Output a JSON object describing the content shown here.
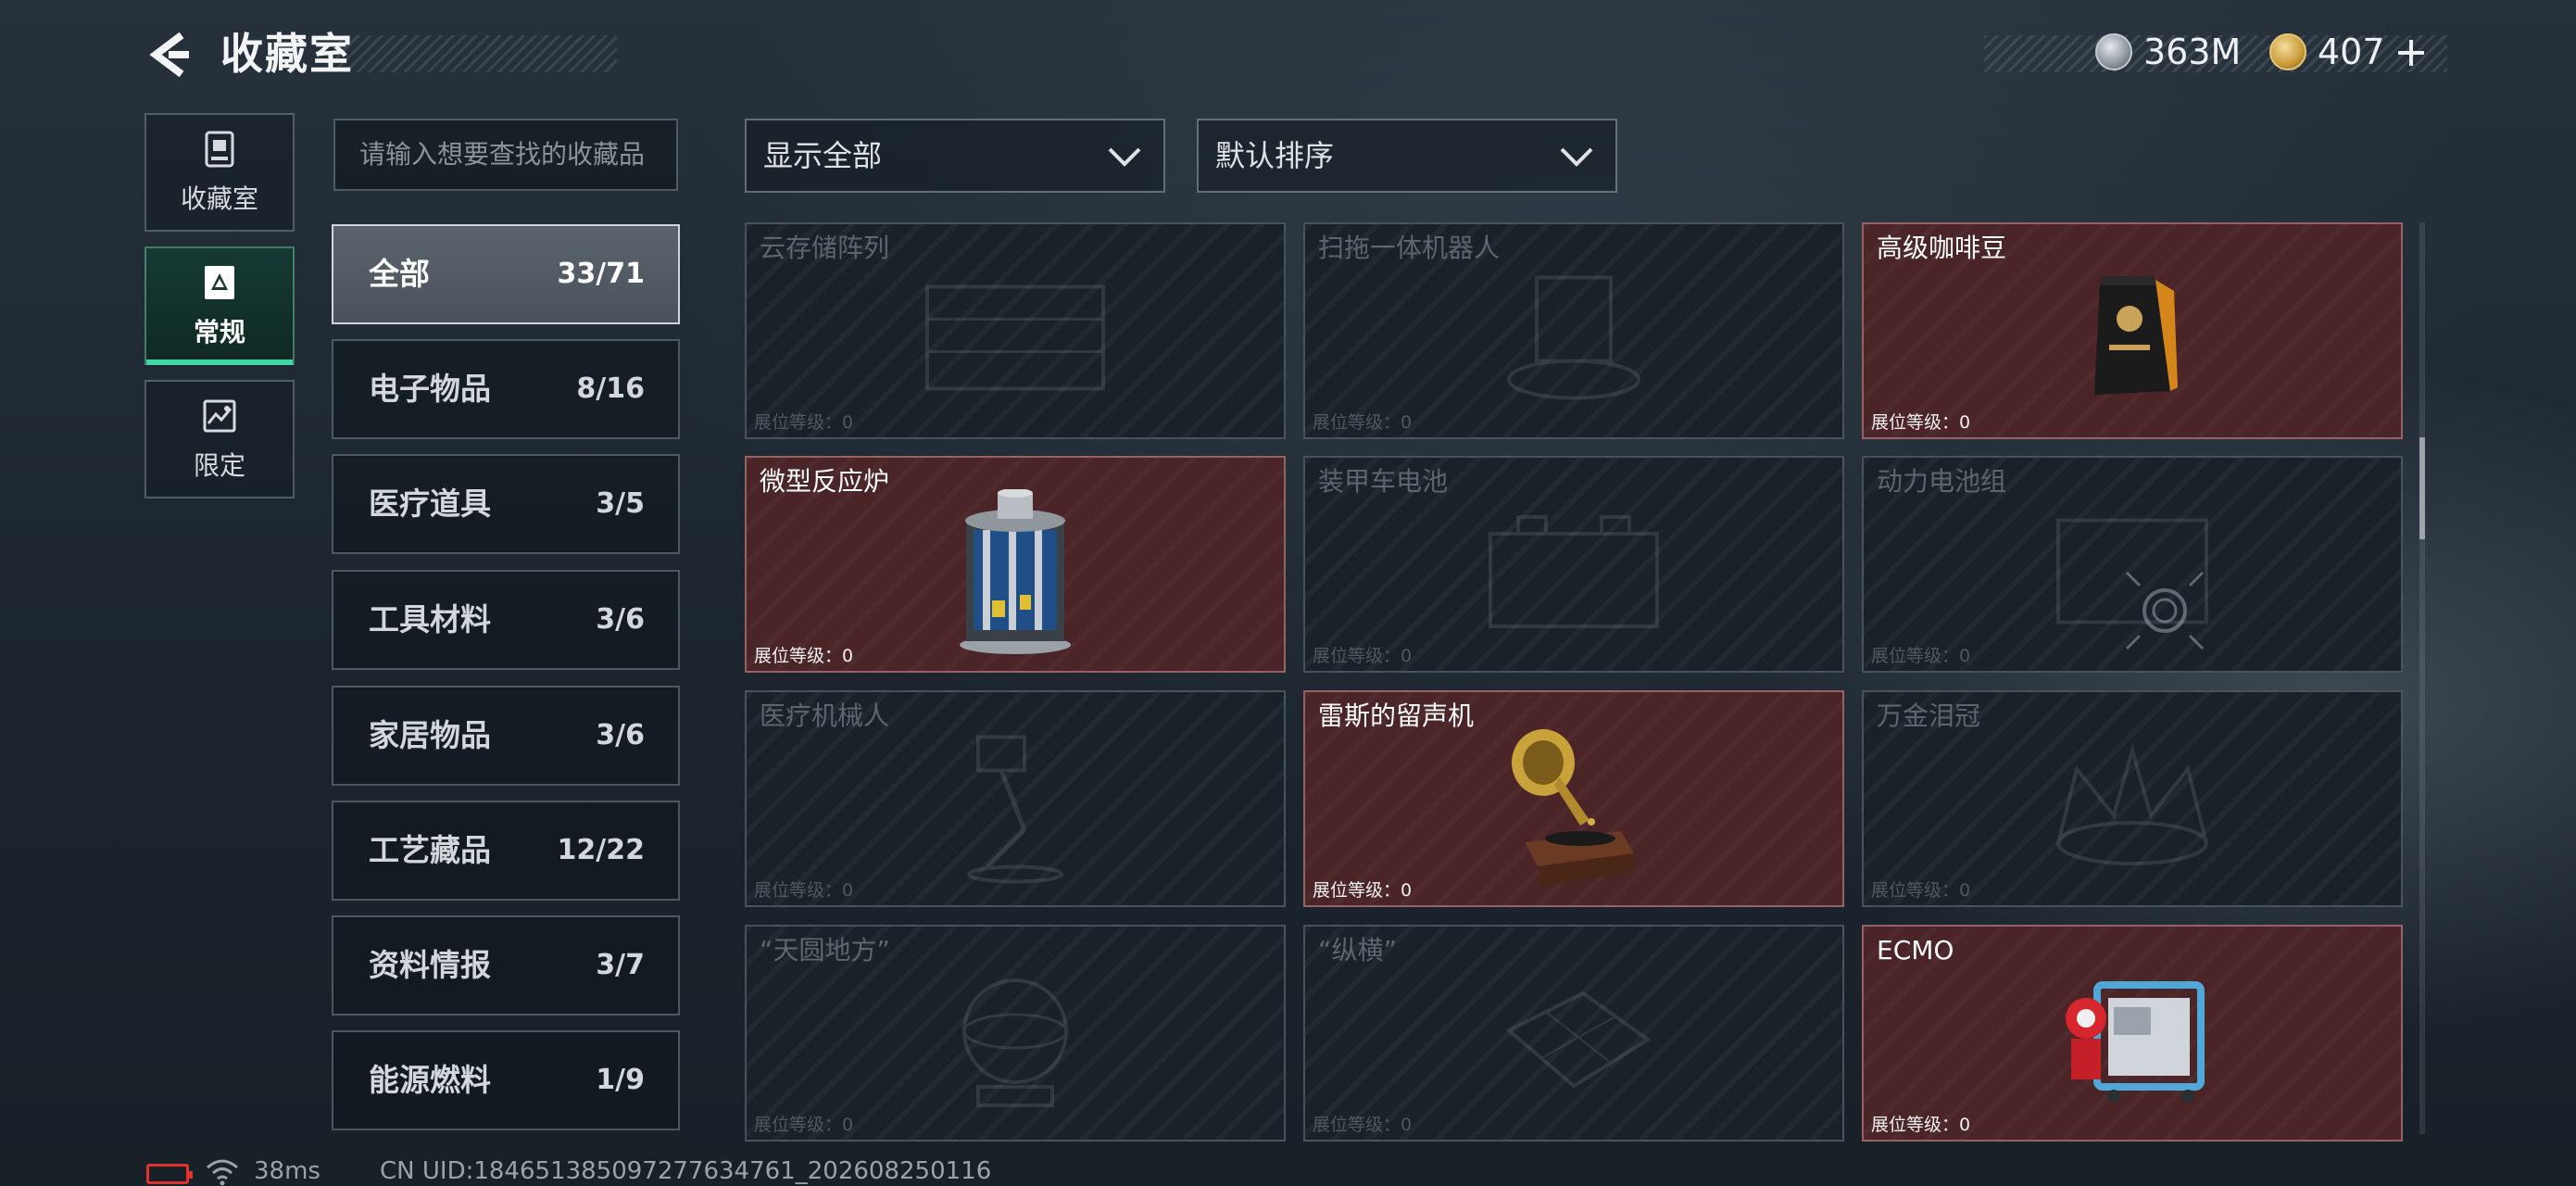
{
  "header": {
    "title": "收藏室",
    "currency_silver": "363M",
    "currency_gold": "407"
  },
  "mode_tabs": [
    {
      "label": "收藏室",
      "icon": "trophy-icon"
    },
    {
      "label": "常规",
      "icon": "collection-icon"
    },
    {
      "label": "限定",
      "icon": "limited-icon"
    }
  ],
  "search": {
    "placeholder": "请输入想要查找的收藏品"
  },
  "filter": {
    "selected": "显示全部"
  },
  "sort": {
    "selected": "默认排序"
  },
  "categories": [
    {
      "name": "全部",
      "count": "33/71"
    },
    {
      "name": "电子物品",
      "count": "8/16"
    },
    {
      "name": "医疗道具",
      "count": "3/5"
    },
    {
      "name": "工具材料",
      "count": "3/6"
    },
    {
      "name": "家居物品",
      "count": "3/6"
    },
    {
      "name": "工艺藏品",
      "count": "12/22"
    },
    {
      "name": "资料情报",
      "count": "3/7"
    },
    {
      "name": "能源燃料",
      "count": "1/9"
    }
  ],
  "items": [
    {
      "name": "云存储阵列",
      "level": "展位等级：0",
      "owned": false
    },
    {
      "name": "扫拖一体机器人",
      "level": "展位等级：0",
      "owned": false
    },
    {
      "name": "高级咖啡豆",
      "level": "展位等级：0",
      "owned": true
    },
    {
      "name": "微型反应炉",
      "level": "展位等级：0",
      "owned": true
    },
    {
      "name": "装甲车电池",
      "level": "展位等级：0",
      "owned": false
    },
    {
      "name": "动力电池组",
      "level": "展位等级：0",
      "owned": false
    },
    {
      "name": "医疗机械人",
      "level": "展位等级：0",
      "owned": false
    },
    {
      "name": "雷斯的留声机",
      "level": "展位等级：0",
      "owned": true
    },
    {
      "name": "万金泪冠",
      "level": "展位等级：0",
      "owned": false
    },
    {
      "name": "“天圆地方”",
      "level": "展位等级：0",
      "owned": false
    },
    {
      "name": "“纵横”",
      "level": "展位等级：0",
      "owned": false
    },
    {
      "name": "ECMO",
      "level": "展位等级：0",
      "owned": true
    }
  ],
  "status": {
    "ping": "38ms",
    "uid": "CN UID:184651385097277634761_202608250116"
  },
  "colors": {
    "accent": "#3fd8a0",
    "owned_card": "#4a2427",
    "locked_card": "#1a2129",
    "battery_low": "#e0332e"
  }
}
